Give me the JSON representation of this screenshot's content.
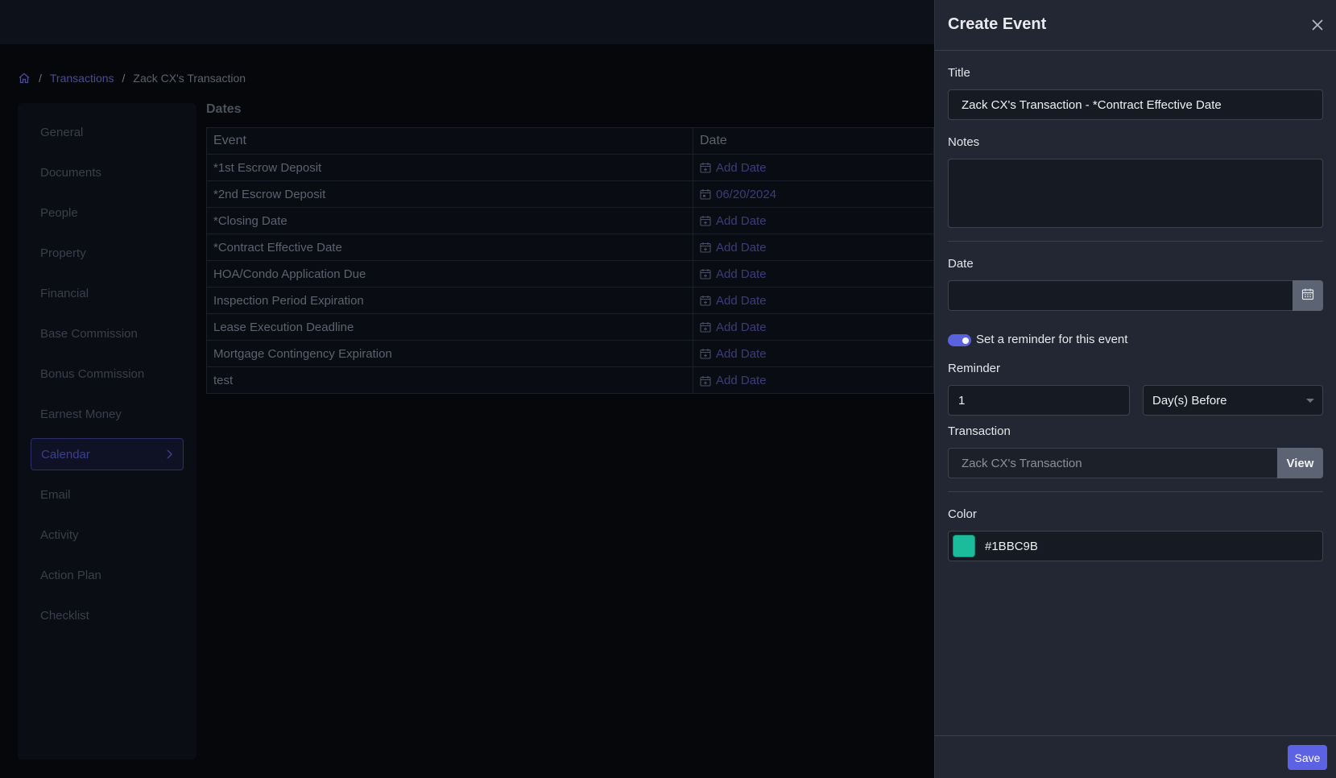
{
  "breadcrumb": {
    "transactions": "Transactions",
    "current": "Zack CX's Transaction",
    "separator": "/"
  },
  "sidebar": {
    "items": [
      {
        "label": "General"
      },
      {
        "label": "Documents"
      },
      {
        "label": "People"
      },
      {
        "label": "Property"
      },
      {
        "label": "Financial"
      },
      {
        "label": "Base Commission"
      },
      {
        "label": "Bonus Commission"
      },
      {
        "label": "Earnest Money"
      },
      {
        "label": "Calendar",
        "active": true
      },
      {
        "label": "Email"
      },
      {
        "label": "Activity"
      },
      {
        "label": "Action Plan"
      },
      {
        "label": "Checklist"
      }
    ]
  },
  "dates": {
    "title": "Dates",
    "columns": {
      "event": "Event",
      "date": "Date"
    },
    "rows": [
      {
        "event": "*1st Escrow Deposit",
        "date": "Add Date"
      },
      {
        "event": "*2nd Escrow Deposit",
        "date": "06/20/2024"
      },
      {
        "event": "*Closing Date",
        "date": "Add Date"
      },
      {
        "event": "*Contract Effective Date",
        "date": "Add Date"
      },
      {
        "event": "HOA/Condo Application Due",
        "date": "Add Date"
      },
      {
        "event": "Inspection Period Expiration",
        "date": "Add Date"
      },
      {
        "event": "Lease Execution Deadline",
        "date": "Add Date"
      },
      {
        "event": "Mortgage Contingency Expiration",
        "date": "Add Date"
      },
      {
        "event": "test",
        "date": "Add Date"
      }
    ]
  },
  "panel": {
    "title": "Create Event",
    "title_label": "Title",
    "title_value": "Zack CX's Transaction - *Contract Effective Date",
    "notes_label": "Notes",
    "notes_value": "",
    "date_label": "Date",
    "date_value": "",
    "reminder_toggle_label": "Set a reminder for this event",
    "reminder_toggle_on": true,
    "reminder_label": "Reminder",
    "reminder_value": "1",
    "reminder_unit": "Day(s) Before",
    "transaction_label": "Transaction",
    "transaction_value": "Zack CX's Transaction",
    "view_label": "View",
    "color_label": "Color",
    "color_value": "#1BBC9B",
    "save_label": "Save"
  },
  "colors": {
    "accent": "#5c62e3",
    "swatch": "#1BBC9B",
    "panel_bg": "#222733",
    "page_bg": "#05070b"
  },
  "icons": {
    "home": "home-icon",
    "close": "close-icon",
    "calendar": "calendar-icon",
    "chevron": "chevron-right-icon"
  }
}
